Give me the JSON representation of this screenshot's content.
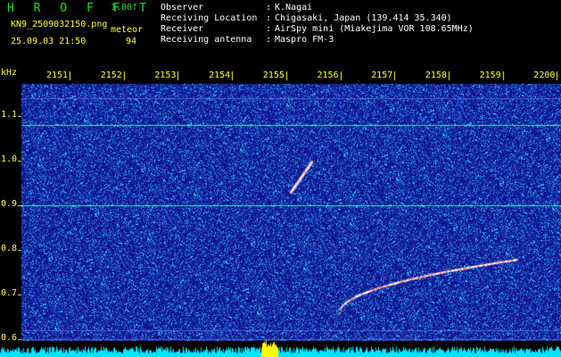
{
  "app": {
    "title": "H R O F F T",
    "version": "1.00f",
    "file": "KN9_2509032150.png",
    "mode_label": "meteor",
    "datetime": "25.09.03 21:50",
    "count": "94"
  },
  "info": [
    {
      "label": "Observer",
      "value": "K.Nagai"
    },
    {
      "label": "Receiving Location",
      "value": "Chigasaki, Japan (139.414 35.340)"
    },
    {
      "label": "Receiver",
      "value": "AirSpy mini (Miakejima VOR 108.65MHz)"
    },
    {
      "label": "Receiving antenna",
      "value": "Maspro FM-3"
    }
  ],
  "plot": {
    "y_unit": "kHz",
    "y_ticks": [
      "1.1",
      "1.0",
      "0.9",
      "0.8",
      "0.7",
      "0.6"
    ],
    "x_ticks": [
      "2151",
      "2152",
      "2153",
      "2154",
      "2155",
      "2156",
      "2157",
      "2158",
      "2159",
      "2200"
    ],
    "carrier_frequencies_khz": [
      1.08,
      0.9,
      1.14,
      0.62,
      0.6
    ],
    "meteor_traces": [
      {
        "start_time": "2155.3",
        "end_time": "2155.7",
        "start_khz": 0.93,
        "end_khz": 1.0
      },
      {
        "start_time": "2156.2",
        "end_time": "2159.5",
        "start_khz": 0.66,
        "end_khz": 0.78
      }
    ],
    "colors": {
      "background": "#10128a",
      "noise_low": "#2540c0",
      "noise_high": "#30e0ff",
      "carrier": "#40ffd0",
      "meteor_hot": "#ff8080",
      "bottom_bar": "#00e6ff",
      "bottom_peak": "#ffff00",
      "text_yellow": "#ffff30",
      "text_green": "#18e018"
    }
  }
}
